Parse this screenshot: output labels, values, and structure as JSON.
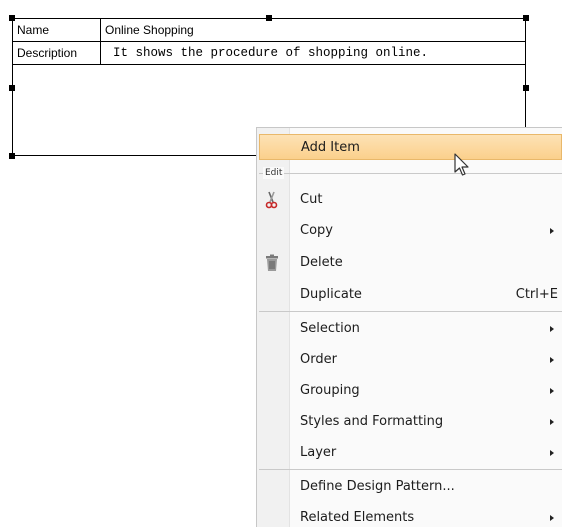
{
  "diagram": {
    "table": [
      {
        "key": "Name",
        "value": "Online Shopping"
      },
      {
        "key": "Description",
        "value": "It shows the procedure of shopping online."
      }
    ]
  },
  "menu": {
    "highlighted": "Add Item",
    "top_item": "Add Item",
    "group_label": "Edit",
    "items": {
      "cut": "Cut",
      "copy": "Copy",
      "delete": "Delete",
      "duplicate": "Duplicate",
      "duplicate_shortcut": "Ctrl+E",
      "selection": "Selection",
      "order": "Order",
      "grouping": "Grouping",
      "styles": "Styles and Formatting",
      "layer": "Layer",
      "define_pattern": "Define Design Pattern...",
      "related": "Related Elements"
    },
    "icons": {
      "cut": "scissors-icon",
      "delete": "trash-icon"
    }
  }
}
